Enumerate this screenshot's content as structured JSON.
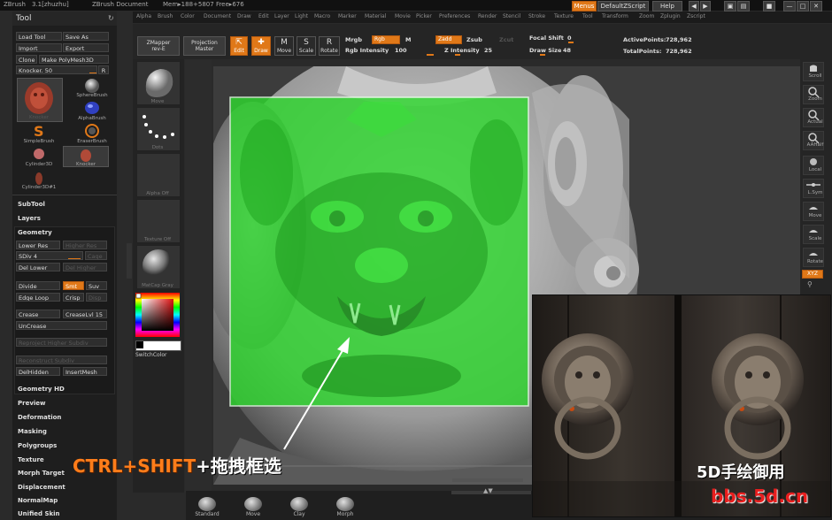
{
  "titlebar": {
    "app": "ZBrush",
    "version": "3.1[zhuzhu]",
    "doc": "ZBrush Document",
    "mem": "Mem▸188+5807 Free▸676",
    "menus_btn": "Menus",
    "script_btn": "DefaultZScript",
    "help_btn": "Help"
  },
  "menubar": [
    "Alpha",
    "Brush",
    "Color",
    "Document",
    "Draw",
    "Edit",
    "Layer",
    "Light",
    "Macro",
    "Marker",
    "Material",
    "Movie",
    "Picker",
    "Preferences",
    "Render",
    "Stencil",
    "Stroke",
    "Texture",
    "Tool",
    "Transform",
    "Zoom",
    "Zplugin",
    "Zscript"
  ],
  "tool": {
    "title": "Tool",
    "load_tool": "Load Tool",
    "save_as": "Save As",
    "import": "Import",
    "export": "Export",
    "clone": "Clone",
    "make_polymesh": "Make PolyMesh3D",
    "slider_label": "Knocker.",
    "slider_value": "50",
    "r_btn": "R",
    "thumbs": [
      "Knocker",
      "SphereBrush",
      "AlphaBrush",
      "SimpleBrush",
      "EraserBrush",
      "Cylinder3D",
      "Knocker",
      "Cylinder3D#1"
    ],
    "sections": [
      "SubTool",
      "Layers"
    ],
    "geometry": {
      "title": "Geometry",
      "lower_res": "Lower Res",
      "higher_res": "Higher Res",
      "sdiv_label": "SDiv",
      "sdiv_value": "4",
      "cage": "Cage",
      "del_lower": "Del Lower",
      "del_higher": "Del Higher",
      "divide": "Divide",
      "smt": "Smt",
      "suv": "Suv",
      "edge_loop": "Edge Loop",
      "crisp": "Crisp",
      "disp": "Disp",
      "crease": "Crease",
      "creaselvl_label": "CreaseLvl",
      "creaselvl_value": "15",
      "uncrease": "UnCrease",
      "reproject": "Reproject Higher Subdiv",
      "reconstruct": "Reconstruct Subdiv",
      "delhidden": "DelHidden",
      "insertmesh": "InsertMesh"
    },
    "lower_sections": [
      "Geometry HD",
      "Preview",
      "Deformation",
      "Masking",
      "Polygroups",
      "Texture",
      "Morph Target",
      "Displacement",
      "NormalMap",
      "Unified Skin"
    ]
  },
  "shelf": {
    "zmapper": "ZMapper",
    "zmapper_rev": "rev-E",
    "projection": "Projection",
    "projection_sub": "Master",
    "edit": "Edit",
    "draw": "Draw",
    "move": "Move",
    "scale": "Scale",
    "rotate": "Rotate",
    "mrgb": "Mrgb",
    "rgb": "Rgb",
    "m": "M",
    "rgb_intensity_label": "Rgb Intensity",
    "rgb_intensity_value": "100",
    "zadd": "Zadd",
    "zsub": "Zsub",
    "zcut": "Zcut",
    "z_intensity_label": "Z Intensity",
    "z_intensity_value": "25",
    "focal_label": "Focal Shift",
    "focal_value": "0",
    "drawsize_label": "Draw Size",
    "drawsize_value": "48",
    "active_label": "ActivePoints:",
    "active_value": "728,962",
    "total_label": "TotalPoints:",
    "total_value": "728,962"
  },
  "left_shelf": [
    "Move",
    "Dots",
    "Alpha Off",
    "Texture Off",
    "MatCap Gray"
  ],
  "switch_color": "SwitchColor",
  "right_shelf": [
    "Scroll",
    "Zoom",
    "Actual",
    "AAHalf",
    "Local",
    "L.Sym",
    "Move",
    "Scale",
    "Rotate",
    "XYZ"
  ],
  "bottom_shelf": [
    "Standard",
    "Move",
    "Clay",
    "Morph"
  ],
  "caption": {
    "keys": "CTRL+SHIFT",
    "plus": "+",
    "action": "拖拽框选"
  },
  "watermark": {
    "line1": "5D手绘御用",
    "line2": "bbs.5d.cn"
  },
  "colors": {
    "accent": "#e07818",
    "selection": "#2fd62f",
    "caption_orange": "#ff7d1a",
    "watermark_red": "#e81e1e"
  }
}
